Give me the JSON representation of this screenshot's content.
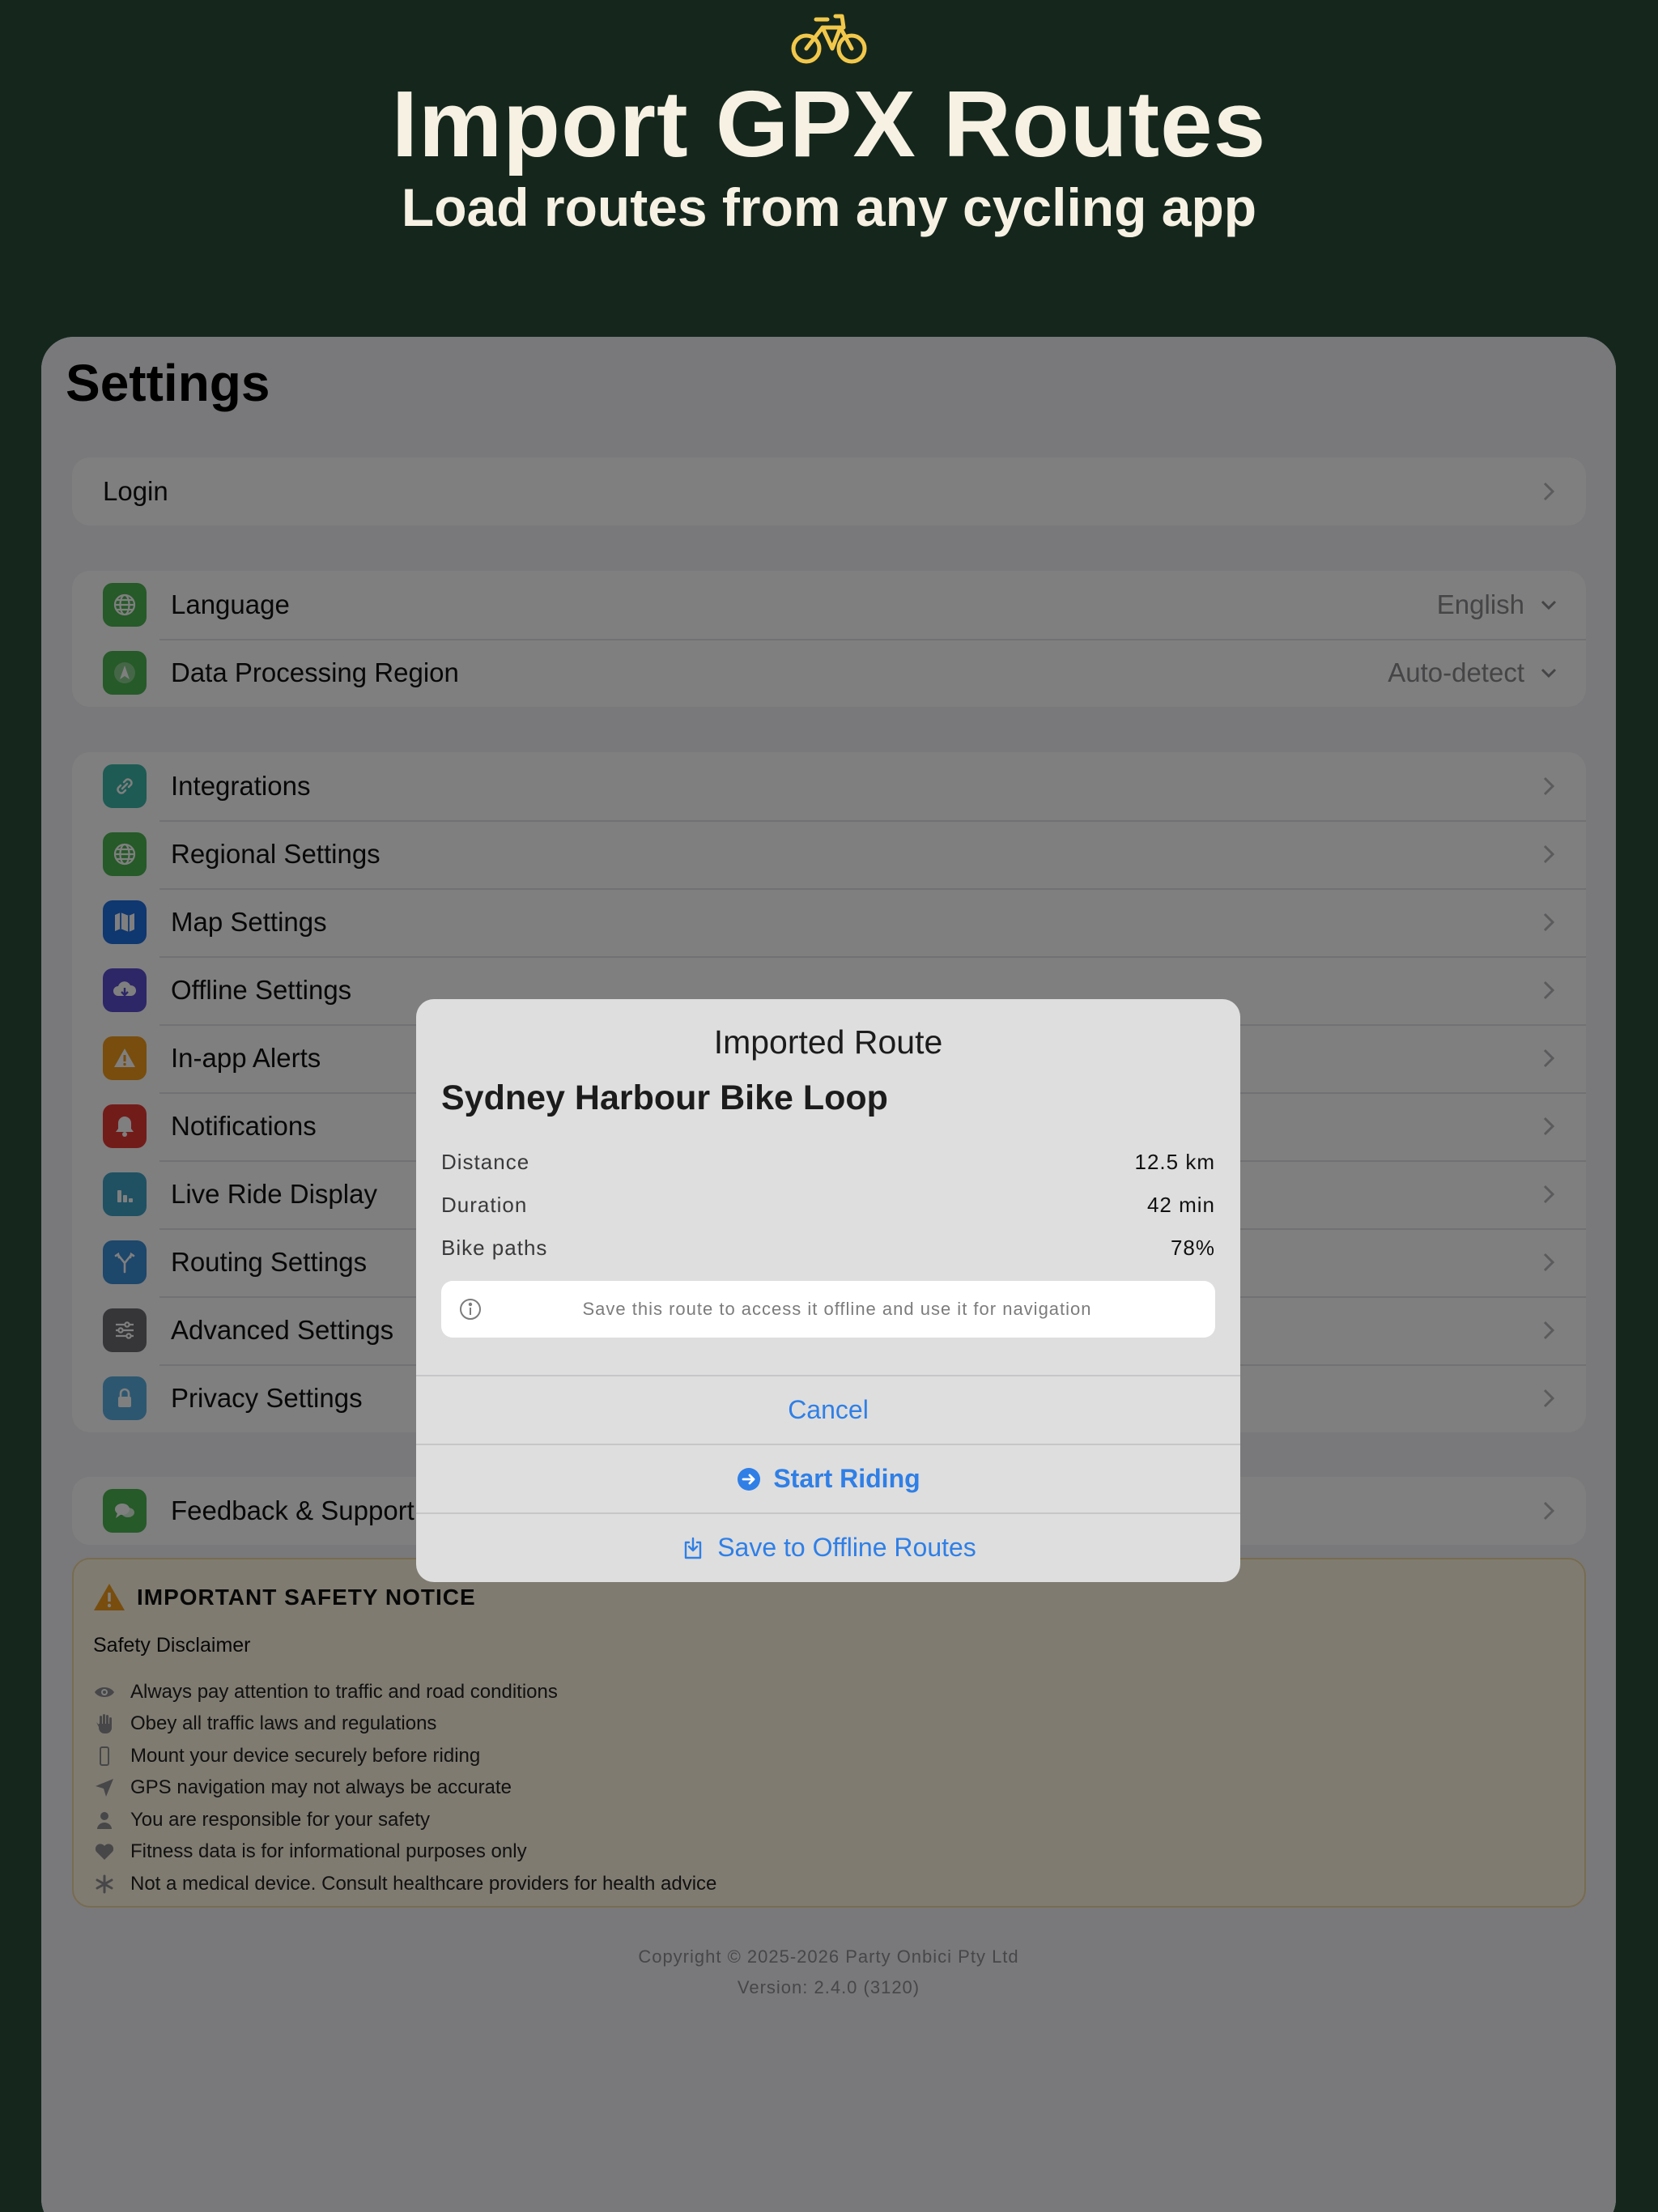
{
  "hero": {
    "icon": "bicycle-icon",
    "title": "Import GPX Routes",
    "subtitle": "Load routes from any cycling app"
  },
  "settings": {
    "title": "Settings",
    "login": {
      "label": "Login"
    },
    "language": {
      "label": "Language",
      "value": "English"
    },
    "region": {
      "label": "Data Processing Region",
      "value": "Auto-detect"
    },
    "items": [
      {
        "label": "Integrations",
        "icon": "link-icon",
        "color": "#3bb6a8"
      },
      {
        "label": "Regional Settings",
        "icon": "globe-icon",
        "color": "#4cb452"
      },
      {
        "label": "Map Settings",
        "icon": "map-icon",
        "color": "#1f6fe0"
      },
      {
        "label": "Offline Settings",
        "icon": "cloud-download-icon",
        "color": "#5a4ed1"
      },
      {
        "label": "In-app Alerts",
        "icon": "warning-icon",
        "color": "#f09a1a"
      },
      {
        "label": "Notifications",
        "icon": "bell-icon",
        "color": "#e53935"
      },
      {
        "label": "Live Ride Display",
        "icon": "bar-chart-icon",
        "color": "#3ea3c7"
      },
      {
        "label": "Routing Settings",
        "icon": "fork-icon",
        "color": "#3a8fd6"
      },
      {
        "label": "Advanced Settings",
        "icon": "sliders-icon",
        "color": "#6d6d72"
      },
      {
        "label": "Privacy Settings",
        "icon": "lock-icon",
        "color": "#5aaee0"
      }
    ],
    "feedback": {
      "label": "Feedback & Support"
    }
  },
  "safety": {
    "title": "IMPORTANT SAFETY NOTICE",
    "subtitle": "Safety Disclaimer",
    "items": [
      "Always pay attention to traffic and road conditions",
      "Obey all traffic laws and regulations",
      "Mount your device securely before riding",
      "GPS navigation may not always be accurate",
      "You are responsible for your safety",
      "Fitness data is for informational purposes only",
      "Not a medical device. Consult healthcare providers for health advice"
    ]
  },
  "footer": {
    "copyright": "Copyright © 2025-2026 Party Onbici Pty Ltd",
    "version": "Version: 2.4.0 (3120)"
  },
  "modal": {
    "title": "Imported Route",
    "route_name": "Sydney Harbour Bike Loop",
    "stats": [
      {
        "label": "Distance",
        "value": "12.5 km"
      },
      {
        "label": "Duration",
        "value": "42 min"
      },
      {
        "label": "Bike paths",
        "value": "78%"
      }
    ],
    "info": "Save this route to access it offline and use it for navigation",
    "cancel": "Cancel",
    "start": "Start Riding",
    "save": "Save to Offline Routes"
  },
  "colors": {
    "background": "#15271d",
    "hero_text": "#f6f1e3",
    "accent": "#2f7fe6",
    "bike_icon": "#f2c84b"
  }
}
